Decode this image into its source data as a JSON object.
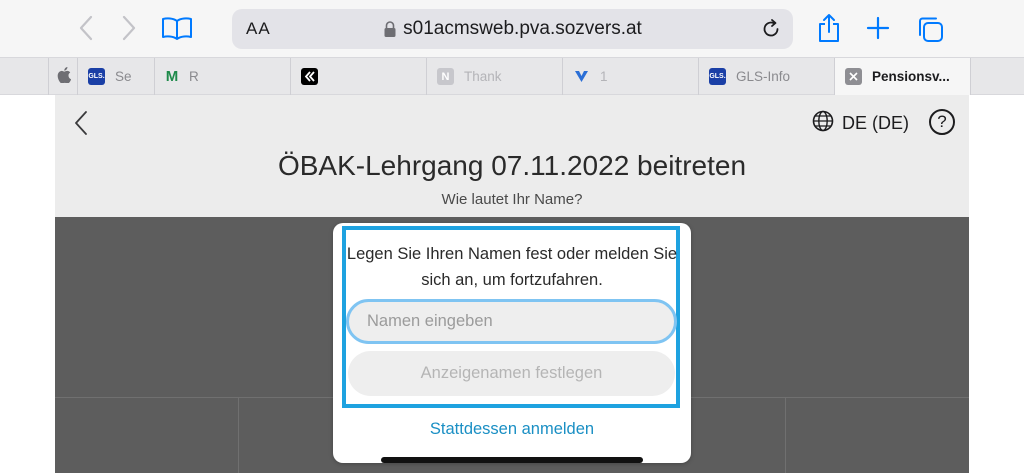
{
  "browser": {
    "text_size_label": "AA",
    "url": "s01acmsweb.pva.sozvers.at",
    "accent_color": "#007aff"
  },
  "tabs": [
    {
      "label": "",
      "favicon": "apple-icon",
      "active": false
    },
    {
      "label": "Se",
      "favicon": "GLS.",
      "favicon_color": "#1a3fa6",
      "active": false
    },
    {
      "label": "R",
      "favicon": "M",
      "favicon_color": "#1e8a4a",
      "active": false
    },
    {
      "label": "",
      "favicon": "k-logo-icon",
      "favicon_color": "#000000",
      "active": false
    },
    {
      "label": "Thank",
      "favicon": "N",
      "favicon_color": "#c7c7cc",
      "active": false
    },
    {
      "label": "1",
      "favicon": "v-logo-icon",
      "favicon_color": "#2b6fd6",
      "active": false
    },
    {
      "label": "GLS-Info",
      "favicon": "GLS.",
      "favicon_color": "#1a3fa6",
      "active": false
    },
    {
      "label": "Pensionsv...",
      "favicon": "close-box-icon",
      "active": true
    }
  ],
  "page": {
    "language": "DE (DE)",
    "help_symbol": "?",
    "title": "ÖBAK-Lehrgang 07.11.2022 beitreten",
    "subtitle": "Wie lautet Ihr Name?"
  },
  "dialog": {
    "message": "Legen Sie Ihren Namen fest oder melden Sie sich an, um fortzufahren.",
    "name_placeholder": "Namen eingeben",
    "name_value": "",
    "set_button": "Anzeigenamen festlegen",
    "signin_link": "Stattdessen anmelden",
    "focus_color": "#1ea2e0",
    "link_color": "#1a8fc4"
  }
}
